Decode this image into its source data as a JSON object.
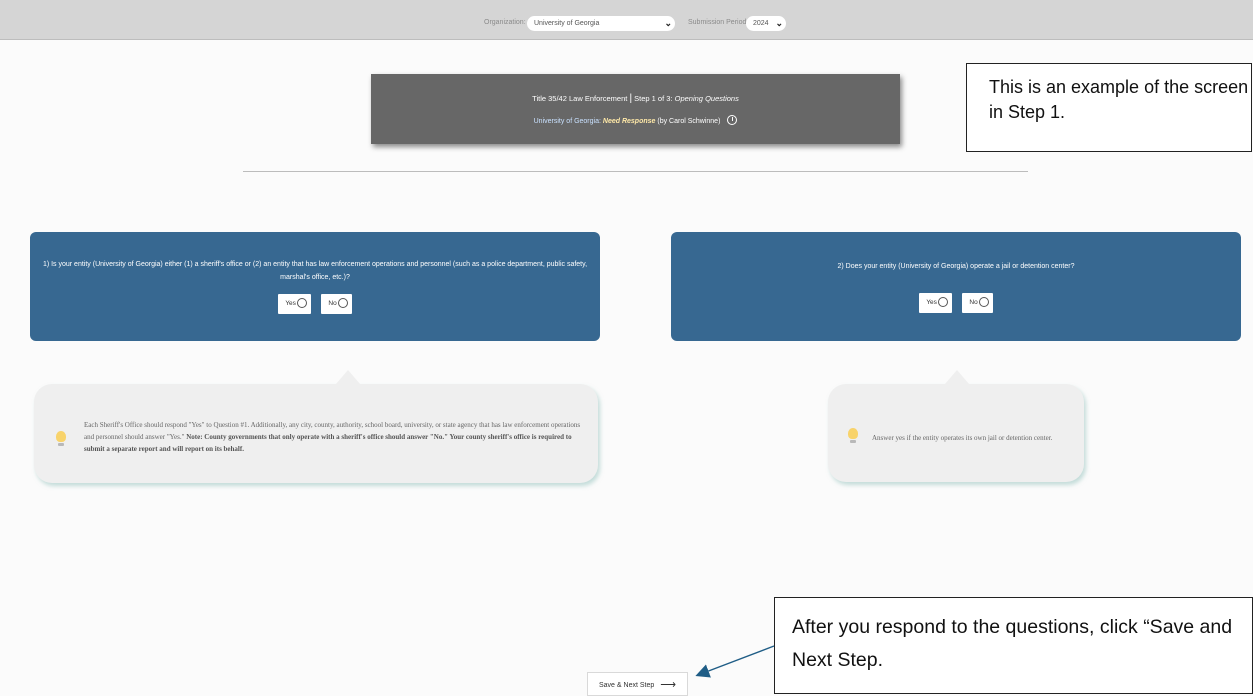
{
  "topbar": {
    "organization_label": "Organization:",
    "organization_value": "University of Georgia",
    "period_label": "Submission Period:",
    "period_value": "2024"
  },
  "header": {
    "title": "Title 35/42 Law Enforcement",
    "separator": "|",
    "step_prefix": "Step 1 of 3:",
    "step_name": "Opening Questions",
    "org_name": "University of Georgia:",
    "status": "Need Response",
    "by": "(by Carol Schwinne)"
  },
  "callouts": {
    "top": "This is an example of the screen in Step 1.",
    "bottom": "After you respond to the questions, click “Save and Next Step."
  },
  "questions": [
    {
      "text": "1) Is your entity (University of Georgia) either (1) a sheriff's office or (2) an entity that has law enforcement operations and personnel (such as a police department, public safety, marshal's office, etc.)?",
      "yes_label": "Yes",
      "no_label": "No",
      "tip_plain": "Each Sheriff's Office should respond \"Yes\" to Question #1. Additionally, any city, county, authority, school board, university, or state agency that has law enforcement operations and personnel should answer \"Yes.\"",
      "tip_bold": "Note: County governments that only operate with a sheriff's office should answer \"No.\" Your county sheriff's office is required to submit a separate report and will report on its behalf."
    },
    {
      "text": "2) Does your entity (University of Georgia) operate a jail or detention center?",
      "yes_label": "Yes",
      "no_label": "No",
      "tip_plain": "Answer yes if the entity operates its own jail or detention center."
    }
  ],
  "footer": {
    "next_label": "Save & Next Step"
  },
  "icons": {
    "bulb": "lightbulb-icon",
    "clock": "clock-icon",
    "arrow": "arrow-right-icon"
  }
}
